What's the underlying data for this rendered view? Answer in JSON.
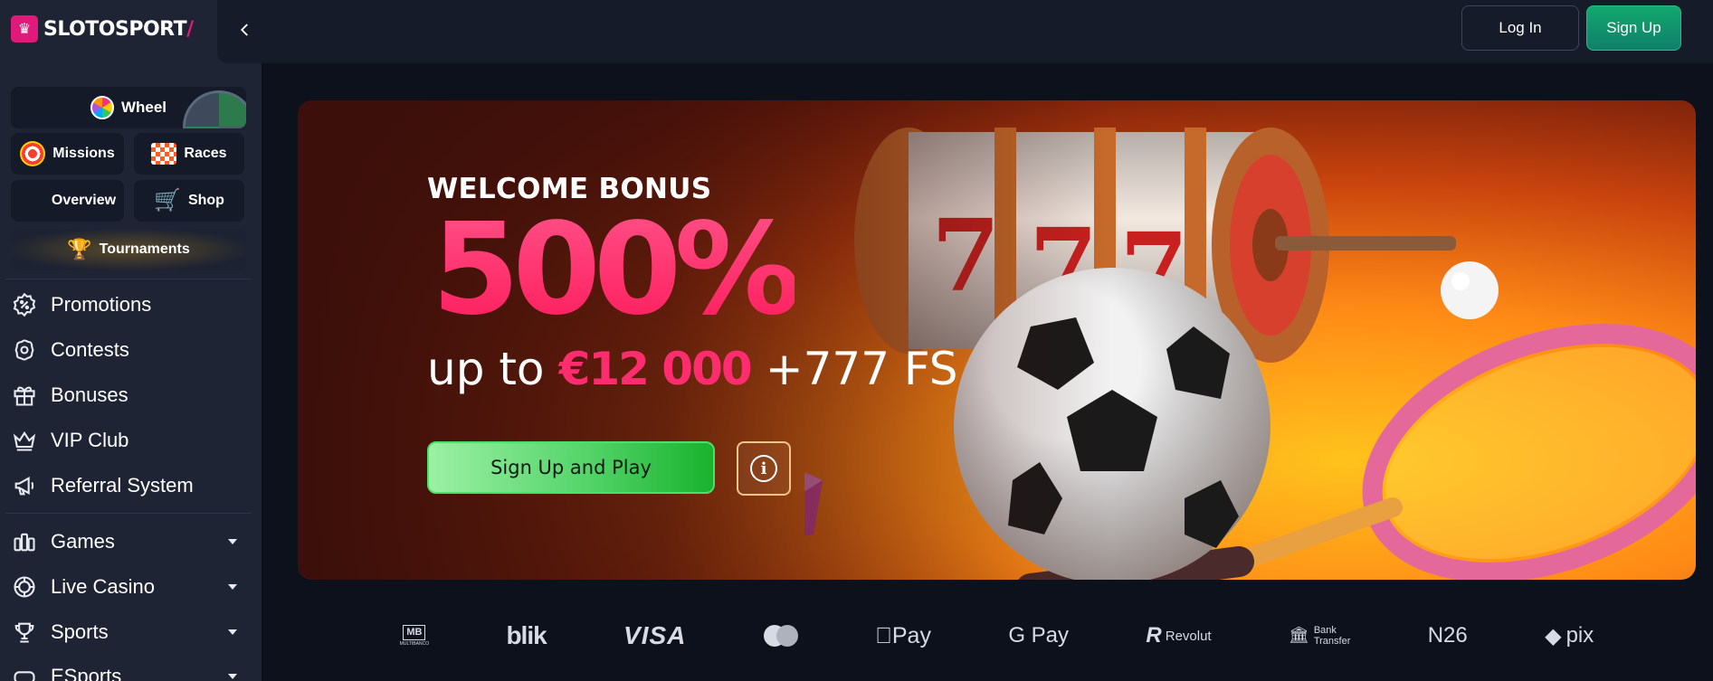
{
  "brand": {
    "logo_text_main": "SLOTOSPORT",
    "logo_text_accent": "/"
  },
  "header": {
    "login_label": "Log In",
    "signup_label": "Sign Up"
  },
  "sidebar": {
    "wheel_label": "Wheel",
    "quick_buttons": {
      "missions": "Missions",
      "races": "Races",
      "overview": "Overview",
      "shop": "Shop",
      "tournaments": "Tournaments"
    },
    "nav_items": [
      {
        "label": "Promotions",
        "icon": "percent-badge-icon"
      },
      {
        "label": "Contests",
        "icon": "award-icon"
      },
      {
        "label": "Bonuses",
        "icon": "gift-icon"
      },
      {
        "label": "VIP Club",
        "icon": "crown-icon"
      },
      {
        "label": "Referral System",
        "icon": "megaphone-icon"
      }
    ],
    "category_items": [
      {
        "label": "Games",
        "icon": "games-icon"
      },
      {
        "label": "Live Casino",
        "icon": "chip-icon"
      },
      {
        "label": "Sports",
        "icon": "trophy-icon"
      },
      {
        "label": "ESports",
        "icon": "esports-icon"
      }
    ]
  },
  "banner": {
    "heading": "WELCOME BONUS",
    "percent": "500%",
    "up_to": "up to",
    "amount": "€12 000",
    "free_spins": "+777 FS",
    "cta_label": "Sign Up and Play",
    "info_symbol": "i"
  },
  "payments": {
    "multibanco_top": "MB",
    "multibanco_bottom": "MULTIBANCO",
    "blik": "blik",
    "visa": "VISA",
    "apple_pay": " Pay",
    "google_pay": "G Pay",
    "revolut_mark": "R",
    "revolut": "Revolut",
    "bank_transfer_line1": "Bank",
    "bank_transfer_line2": "Transfer",
    "n26": "N26",
    "pix": "pix"
  },
  "colors": {
    "accent_pink": "#e0197a",
    "signup_green": "#13a86e",
    "cta_green": "#55d46a",
    "sidebar_bg": "#1f2434",
    "page_bg": "#0d111c"
  }
}
